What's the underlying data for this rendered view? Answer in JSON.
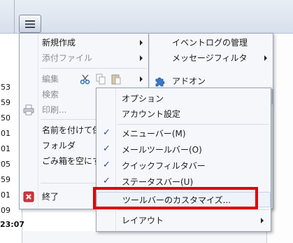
{
  "background": {
    "times": [
      "53",
      "59",
      "50",
      "01",
      "01",
      "05",
      "59",
      "01",
      "09"
    ],
    "bottom_time": "23:07"
  },
  "main_menu": {
    "items": [
      {
        "label": "新規作成",
        "disabled": false
      },
      {
        "label": "添付ファイル",
        "disabled": true
      },
      {
        "label": "編集",
        "disabled": true
      },
      {
        "label": "検索",
        "disabled": true
      },
      {
        "label": "印刷...",
        "disabled": true
      },
      {
        "label": "名前を付けて保",
        "disabled": false
      },
      {
        "label": "フォルダ",
        "disabled": false
      },
      {
        "label": "ごみ箱を空にす",
        "disabled": false
      },
      {
        "label": "終了",
        "disabled": false
      }
    ]
  },
  "tools_panel": {
    "items": [
      {
        "label": "イベントログの管理"
      },
      {
        "label": "メッセージフィルタ"
      },
      {
        "label": "アドオン"
      }
    ]
  },
  "submenu": {
    "items": [
      {
        "label": "オプション"
      },
      {
        "label": "アカウント設定"
      },
      {
        "label": "メニューバー(M)",
        "checked": true
      },
      {
        "label": "メールツールバー(O)",
        "checked": true
      },
      {
        "label": "クイックフィルタバー",
        "checked": true
      },
      {
        "label": "ステータスバー(U)",
        "checked": true
      },
      {
        "label": "ツールバーのカスタマイズ...",
        "checked": false
      },
      {
        "label": "レイアウト",
        "checked": false
      }
    ]
  },
  "colors": {
    "highlight_border": "#e00000",
    "check_color": "#2b4f9a"
  }
}
